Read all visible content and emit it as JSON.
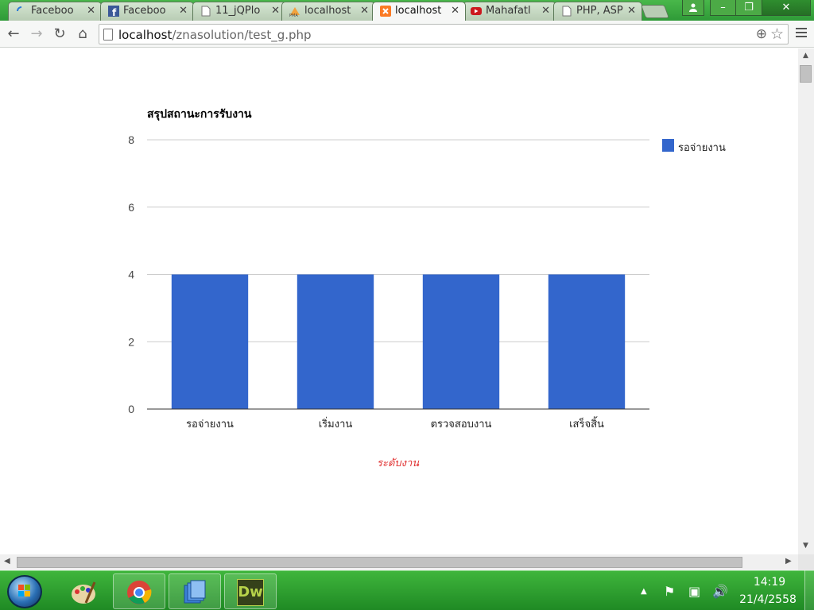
{
  "browser": {
    "tabs": [
      {
        "label": "Faceboo",
        "icon": "loading-icon",
        "active": false
      },
      {
        "label": "Faceboo",
        "icon": "facebook-icon",
        "active": false
      },
      {
        "label": "11_jQPlo",
        "icon": "page-icon",
        "active": false
      },
      {
        "label": "localhost",
        "icon": "phpmyadmin-icon",
        "active": false
      },
      {
        "label": "localhost",
        "icon": "xampp-icon",
        "active": true
      },
      {
        "label": "Mahafatl",
        "icon": "youtube-icon",
        "active": false
      },
      {
        "label": "PHP, ASP",
        "icon": "page-icon",
        "active": false
      }
    ],
    "url_host": "localhost",
    "url_path": "/znasolution/test_g.php"
  },
  "chart_data": {
    "type": "bar",
    "title": "สรุปสถานะการรับงาน",
    "categories": [
      "รอจ่ายงาน",
      "เริ่มงาน",
      "ตรวจสอบงาน",
      "เสร็จสิ้น"
    ],
    "series": [
      {
        "name": "รอจ่ายงาน",
        "values": [
          4,
          4,
          4,
          4
        ],
        "color": "#3366cc"
      }
    ],
    "xlabel": "ระดับงาน",
    "ylabel": "",
    "ylim": [
      0,
      8
    ],
    "yticks": [
      0,
      2,
      4,
      6,
      8
    ],
    "grid": true,
    "legend": "right",
    "xlabel_color": "#e03030"
  },
  "taskbar": {
    "apps": [
      "paint-icon",
      "chrome-icon",
      "explorer-icon",
      "dreamweaver-icon"
    ],
    "dreamweaver_label": "Dw",
    "time": "14:19",
    "date": "21/4/2558"
  }
}
